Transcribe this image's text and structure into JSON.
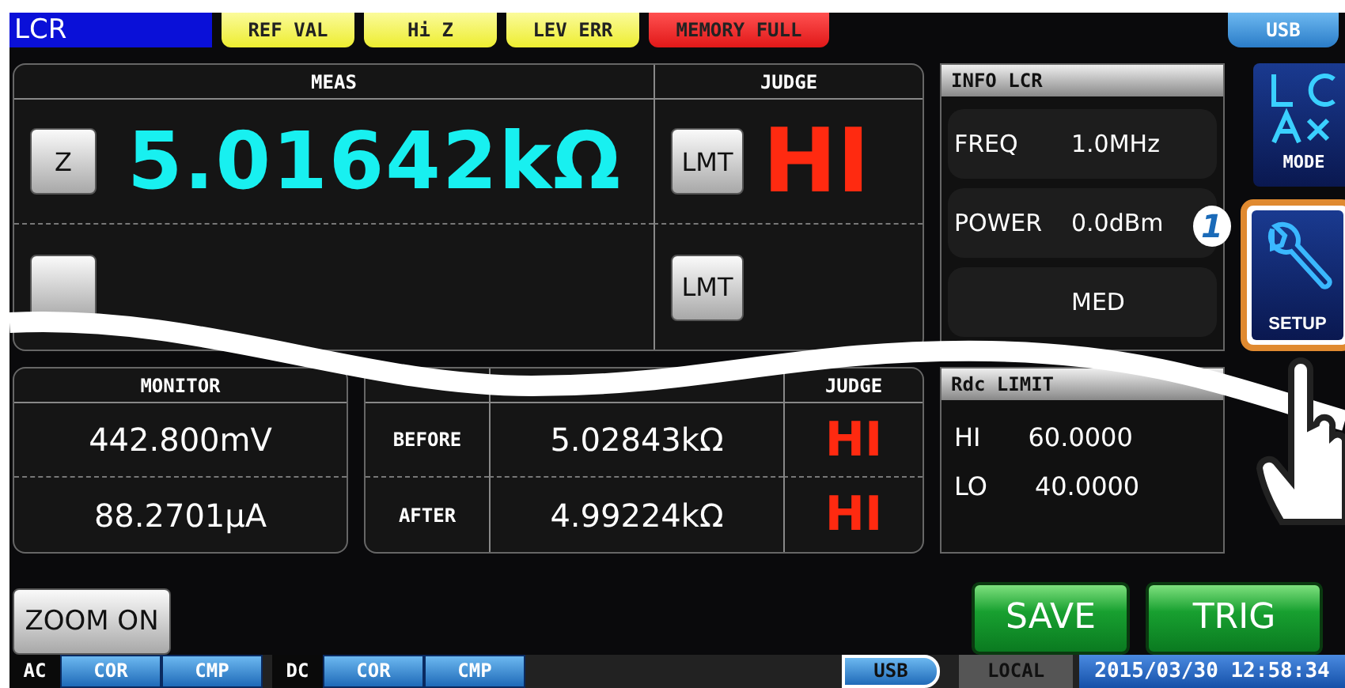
{
  "header": {
    "title": "LCR",
    "tags": [
      {
        "label": "REF VAL",
        "kind": "warning"
      },
      {
        "label": "Hi Z",
        "kind": "warning"
      },
      {
        "label": "LEV ERR",
        "kind": "warning"
      },
      {
        "label": "MEMORY FULL",
        "kind": "error"
      }
    ],
    "usb": "USB"
  },
  "meas": {
    "header": "MEAS",
    "judge_header": "JUDGE",
    "rows": [
      {
        "param": "Z",
        "value": "5.01642kΩ",
        "limit": "LMT",
        "judge": "HI"
      },
      {
        "limit": "LMT"
      }
    ]
  },
  "info": {
    "title": "INFO LCR",
    "rows": [
      {
        "label": "FREQ",
        "value": "1.0MHz"
      },
      {
        "label": "POWER",
        "value": "0.0dBm"
      },
      {
        "value": "MED"
      }
    ]
  },
  "side": {
    "mode": "MODE",
    "setup": "SETUP",
    "callout": "1"
  },
  "monitor": {
    "header": "MONITOR",
    "values": [
      "442.800mV",
      "88.2701μA"
    ]
  },
  "compare": {
    "judge_header": "JUDGE",
    "rows": [
      {
        "label": "BEFORE",
        "value": "5.02843kΩ",
        "judge": "HI"
      },
      {
        "label": "AFTER",
        "value": "4.99224kΩ",
        "judge": "HI"
      }
    ]
  },
  "rdc_limit": {
    "title": "Rdc LIMIT",
    "rows": [
      {
        "label": "HI",
        "value": "60.0000"
      },
      {
        "label": "LO",
        "value": "40.0000"
      }
    ]
  },
  "buttons": {
    "zoom": "ZOOM ON",
    "save": "SAVE",
    "trig": "TRIG"
  },
  "status_bar": {
    "groups": [
      {
        "label": "AC",
        "items": [
          "COR",
          "CMP"
        ]
      },
      {
        "label": "DC",
        "items": [
          "COR",
          "CMP"
        ]
      }
    ],
    "usb": "USB",
    "local": "LOCAL",
    "datetime": "2015/03/30 12:58:34"
  }
}
